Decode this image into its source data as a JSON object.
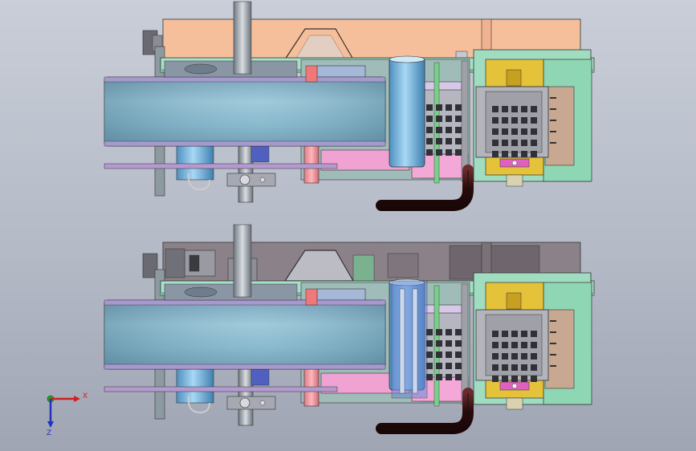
{
  "triad": {
    "x_label": "X",
    "z_label": "Z",
    "x_color": "#d02020",
    "z_color": "#2030c0",
    "y_color": "#20a020"
  },
  "colors": {
    "background_top": "#c9ced8",
    "background_bottom": "#9fa5b3",
    "housing_top_assembly": "#f6bf9c",
    "housing_bottom_assembly": "#8a8288",
    "base_plate": "#9fdcc4",
    "drum": "#7fb4c8",
    "cylinder": "#7fbfe4",
    "terminal_block": "#e2c33c",
    "grid_panel": "#a8a8ae",
    "pink_part": "#f0a2d2",
    "hose": "#3a1212"
  }
}
